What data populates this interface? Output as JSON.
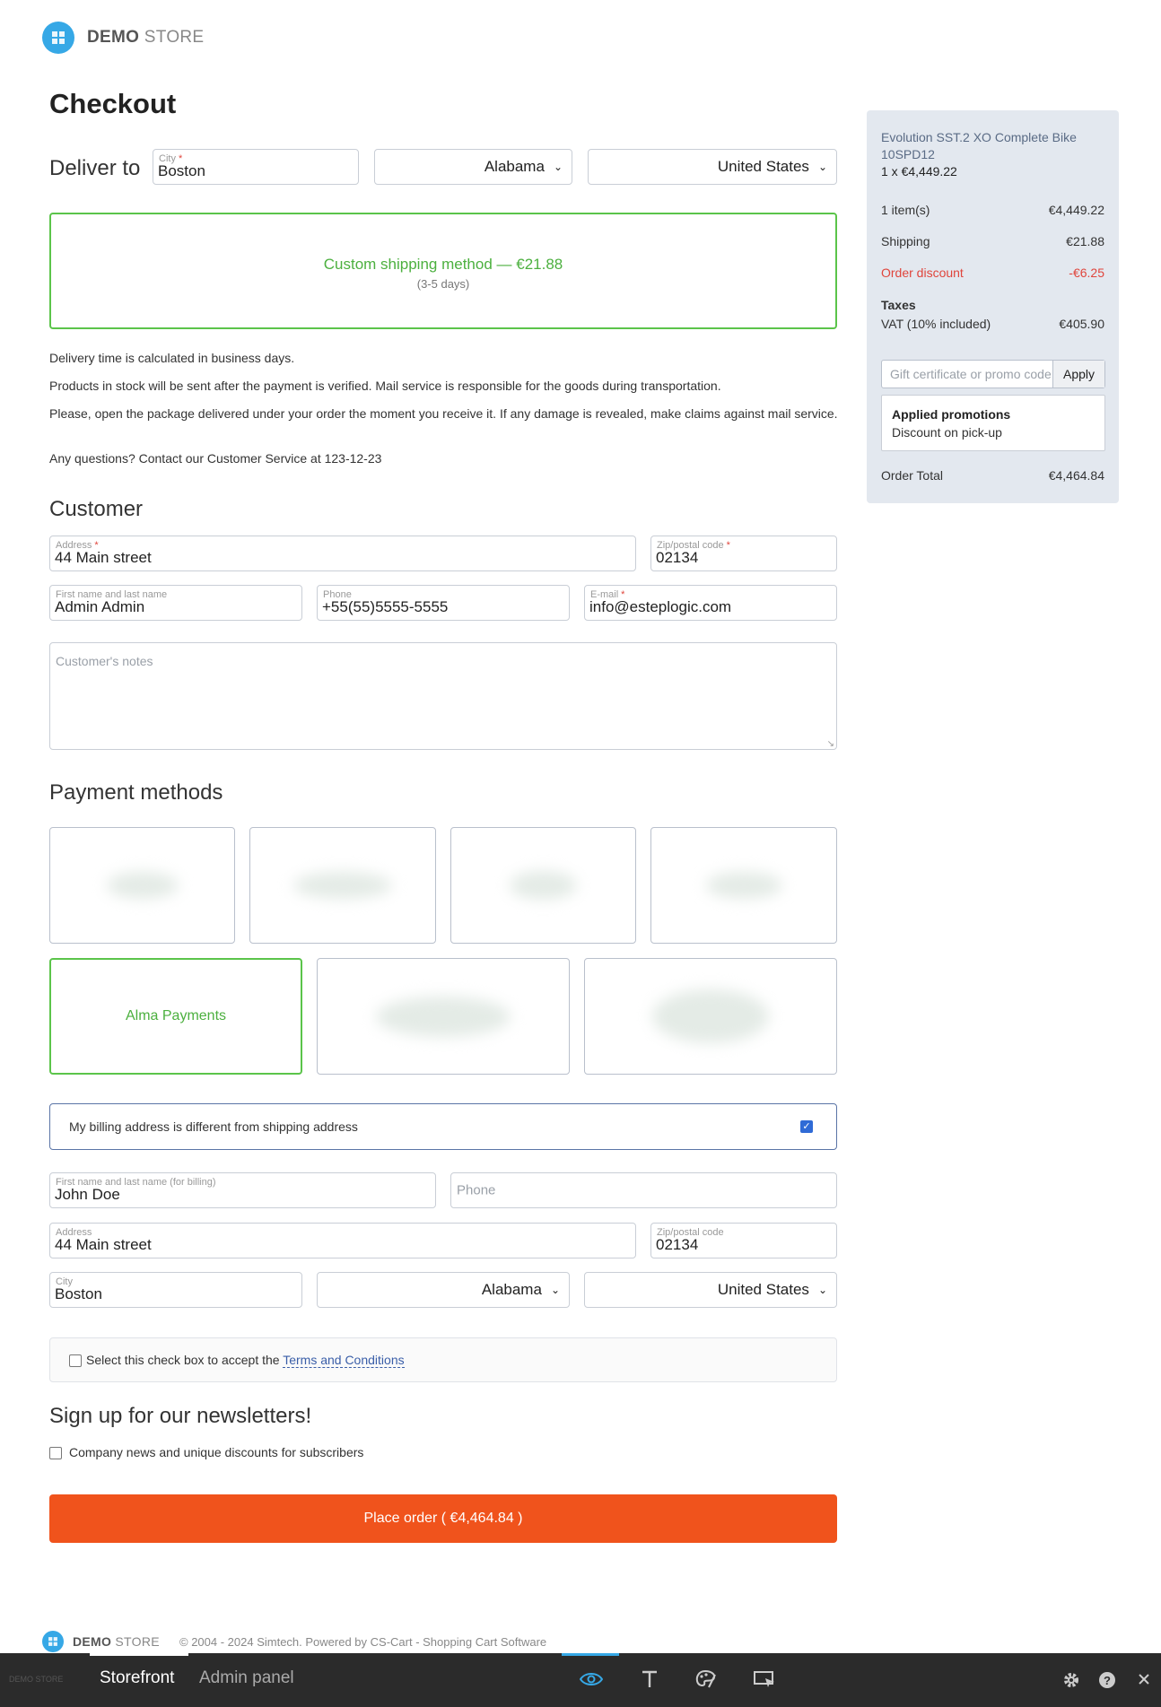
{
  "header": {
    "logo_bold": "DEMO",
    "logo_light": " STORE"
  },
  "page_title": "Checkout",
  "deliver": {
    "label": "Deliver to",
    "city_label": "City",
    "city_value": "Boston",
    "state": "Alabama",
    "country": "United States"
  },
  "shipping": {
    "method": "Custom shipping method — €21.88",
    "eta": "(3-5 days)"
  },
  "notes": [
    "Delivery time is calculated in business days.",
    "Products in stock will be sent after the payment is verified. Mail service is responsible for the goods during transportation.",
    "Please, open the package delivered under your order the moment you receive it. If any damage is revealed, make claims against mail service.",
    "Any questions? Contact our Customer Service at 123-12-23"
  ],
  "customer": {
    "heading": "Customer",
    "address_label": "Address",
    "address_value": "44 Main street",
    "zip_label": "Zip/postal code",
    "zip_value": "02134",
    "name_label": "First name and last name",
    "name_value": "Admin Admin",
    "phone_label": "Phone",
    "phone_value": "+55(55)5555-5555",
    "email_label": "E-mail",
    "email_value": "info@esteplogic.com",
    "notes_placeholder": "Customer's notes"
  },
  "payment": {
    "heading": "Payment methods",
    "selected_label": "Alma Payments"
  },
  "billing": {
    "toggle_label": "My billing address is different from shipping address",
    "toggle_checked": true,
    "name_label": "First name and last name (for billing)",
    "name_value": "John Doe",
    "phone_placeholder": "Phone",
    "address_label": "Address",
    "address_value": "44 Main street",
    "zip_label": "Zip/postal code",
    "zip_value": "02134",
    "city_label": "City",
    "city_value": "Boston",
    "state": "Alabama",
    "country": "United States"
  },
  "terms": {
    "text": "Select this check box to accept the ",
    "link": "Terms and Conditions"
  },
  "newsletter": {
    "heading": "Sign up for our newsletters!",
    "option": "Company news and unique discounts for subscribers"
  },
  "place_order": "Place order ( €4,464.84 )",
  "summary": {
    "product_name": "Evolution SST.2 XO Complete Bike 10SPD12",
    "product_qty": "1 x €4,449.22",
    "items_label": "1 item(s)",
    "items_value": "€4,449.22",
    "shipping_label": "Shipping",
    "shipping_value": "€21.88",
    "discount_label": "Order discount",
    "discount_value": "-€6.25",
    "taxes_label": "Taxes",
    "vat_label": "VAT (10% included)",
    "vat_value": "€405.90",
    "promo_placeholder": "Gift certificate or promo code",
    "apply_label": "Apply",
    "applied_title": "Applied promotions",
    "applied_item": "Discount on pick-up",
    "total_label": "Order Total",
    "total_value": "€4,464.84"
  },
  "footer": {
    "logo_bold": "DEMO",
    "logo_light": " STORE",
    "copyright": "© 2004 - 2024 Simtech.  Powered by CS-Cart - Shopping Cart Software"
  },
  "toolbar": {
    "mini_logo": "DEMO STORE",
    "storefront": "Storefront",
    "admin": "Admin panel",
    "icons": [
      "eye-icon",
      "text-icon",
      "palette-icon",
      "screen-cursor-icon",
      "gear-icon",
      "help-icon",
      "close-icon"
    ]
  },
  "colors": {
    "accent_green": "#4cb03f",
    "brand_blue": "#36a8e6",
    "order_button": "#f0531c",
    "discount_red": "#e0453c"
  }
}
